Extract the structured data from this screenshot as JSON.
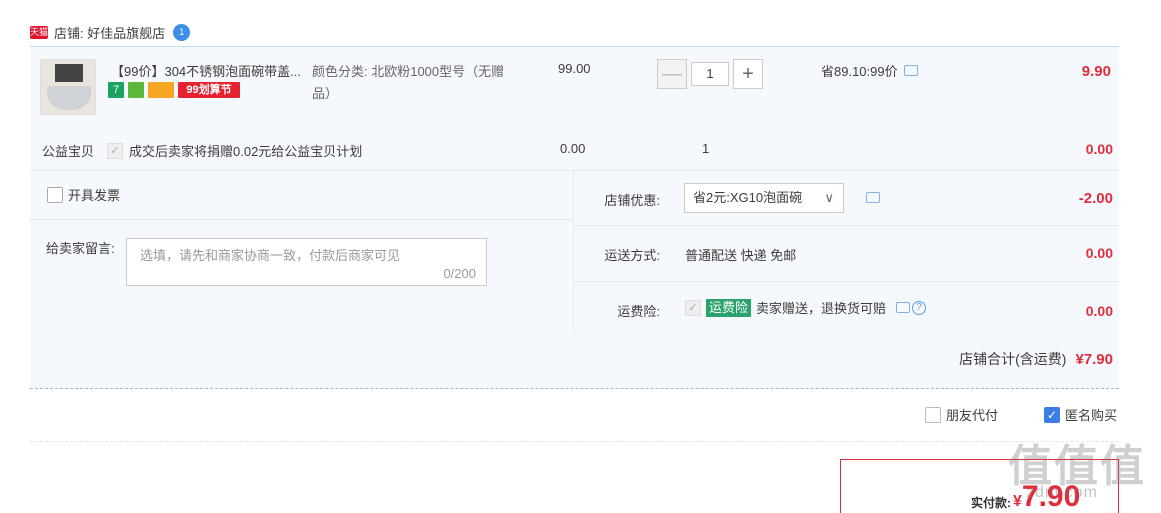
{
  "shop": {
    "tmall_icon": "天猫",
    "name": "店铺: 好佳品旗舰店",
    "badge": "1"
  },
  "item": {
    "title": "【99价】304不锈钢泡面碗带盖...",
    "tags": [
      "7",
      "",
      "",
      "99划算节"
    ],
    "sku": "颜色分类: 北欧粉1000型号（无赠品）",
    "unit_price": "99.00",
    "quantity": "1",
    "minus": "—",
    "plus": "+",
    "discount": "省89.10:99价",
    "line_price": "9.90"
  },
  "charity": {
    "label": "公益宝贝",
    "check": "✓",
    "text": "成交后卖家将捐赠0.02元给公益宝贝计划",
    "price": "0.00",
    "qty": "1",
    "total": "0.00"
  },
  "invoice": {
    "label": "开具发票"
  },
  "remark": {
    "label": "给卖家留言:",
    "placeholder": "选填，请先和商家协商一致，付款后商家可见",
    "count": "0/200"
  },
  "shop_discount": {
    "label": "店铺优惠:",
    "selected": "省2元:XG10泡面碗",
    "chevron": "∨",
    "amount": "-2.00"
  },
  "shipping": {
    "label": "运送方式:",
    "value": "普通配送 快递 免邮",
    "amount": "0.00"
  },
  "insurance": {
    "label": "运费险:",
    "check": "✓",
    "badge": "运费险",
    "text": "卖家赠送，退换货可赔",
    "help": "?",
    "amount": "0.00"
  },
  "shop_total": {
    "label": "店铺合计(含运费)",
    "amount": "¥7.90"
  },
  "options": {
    "friend_pay": "朋友代付",
    "anonymous": "匿名购买",
    "anonymous_check": "✓"
  },
  "payment": {
    "label": "实付款:",
    "currency": "¥",
    "amount": "7.90"
  },
  "watermark": {
    "main": "值值值",
    "sub": "zdm.com"
  },
  "colors": {
    "price_red": "#e02d3c",
    "panel_bg": "#f5f8fc",
    "accent_blue": "#3b7de9"
  }
}
